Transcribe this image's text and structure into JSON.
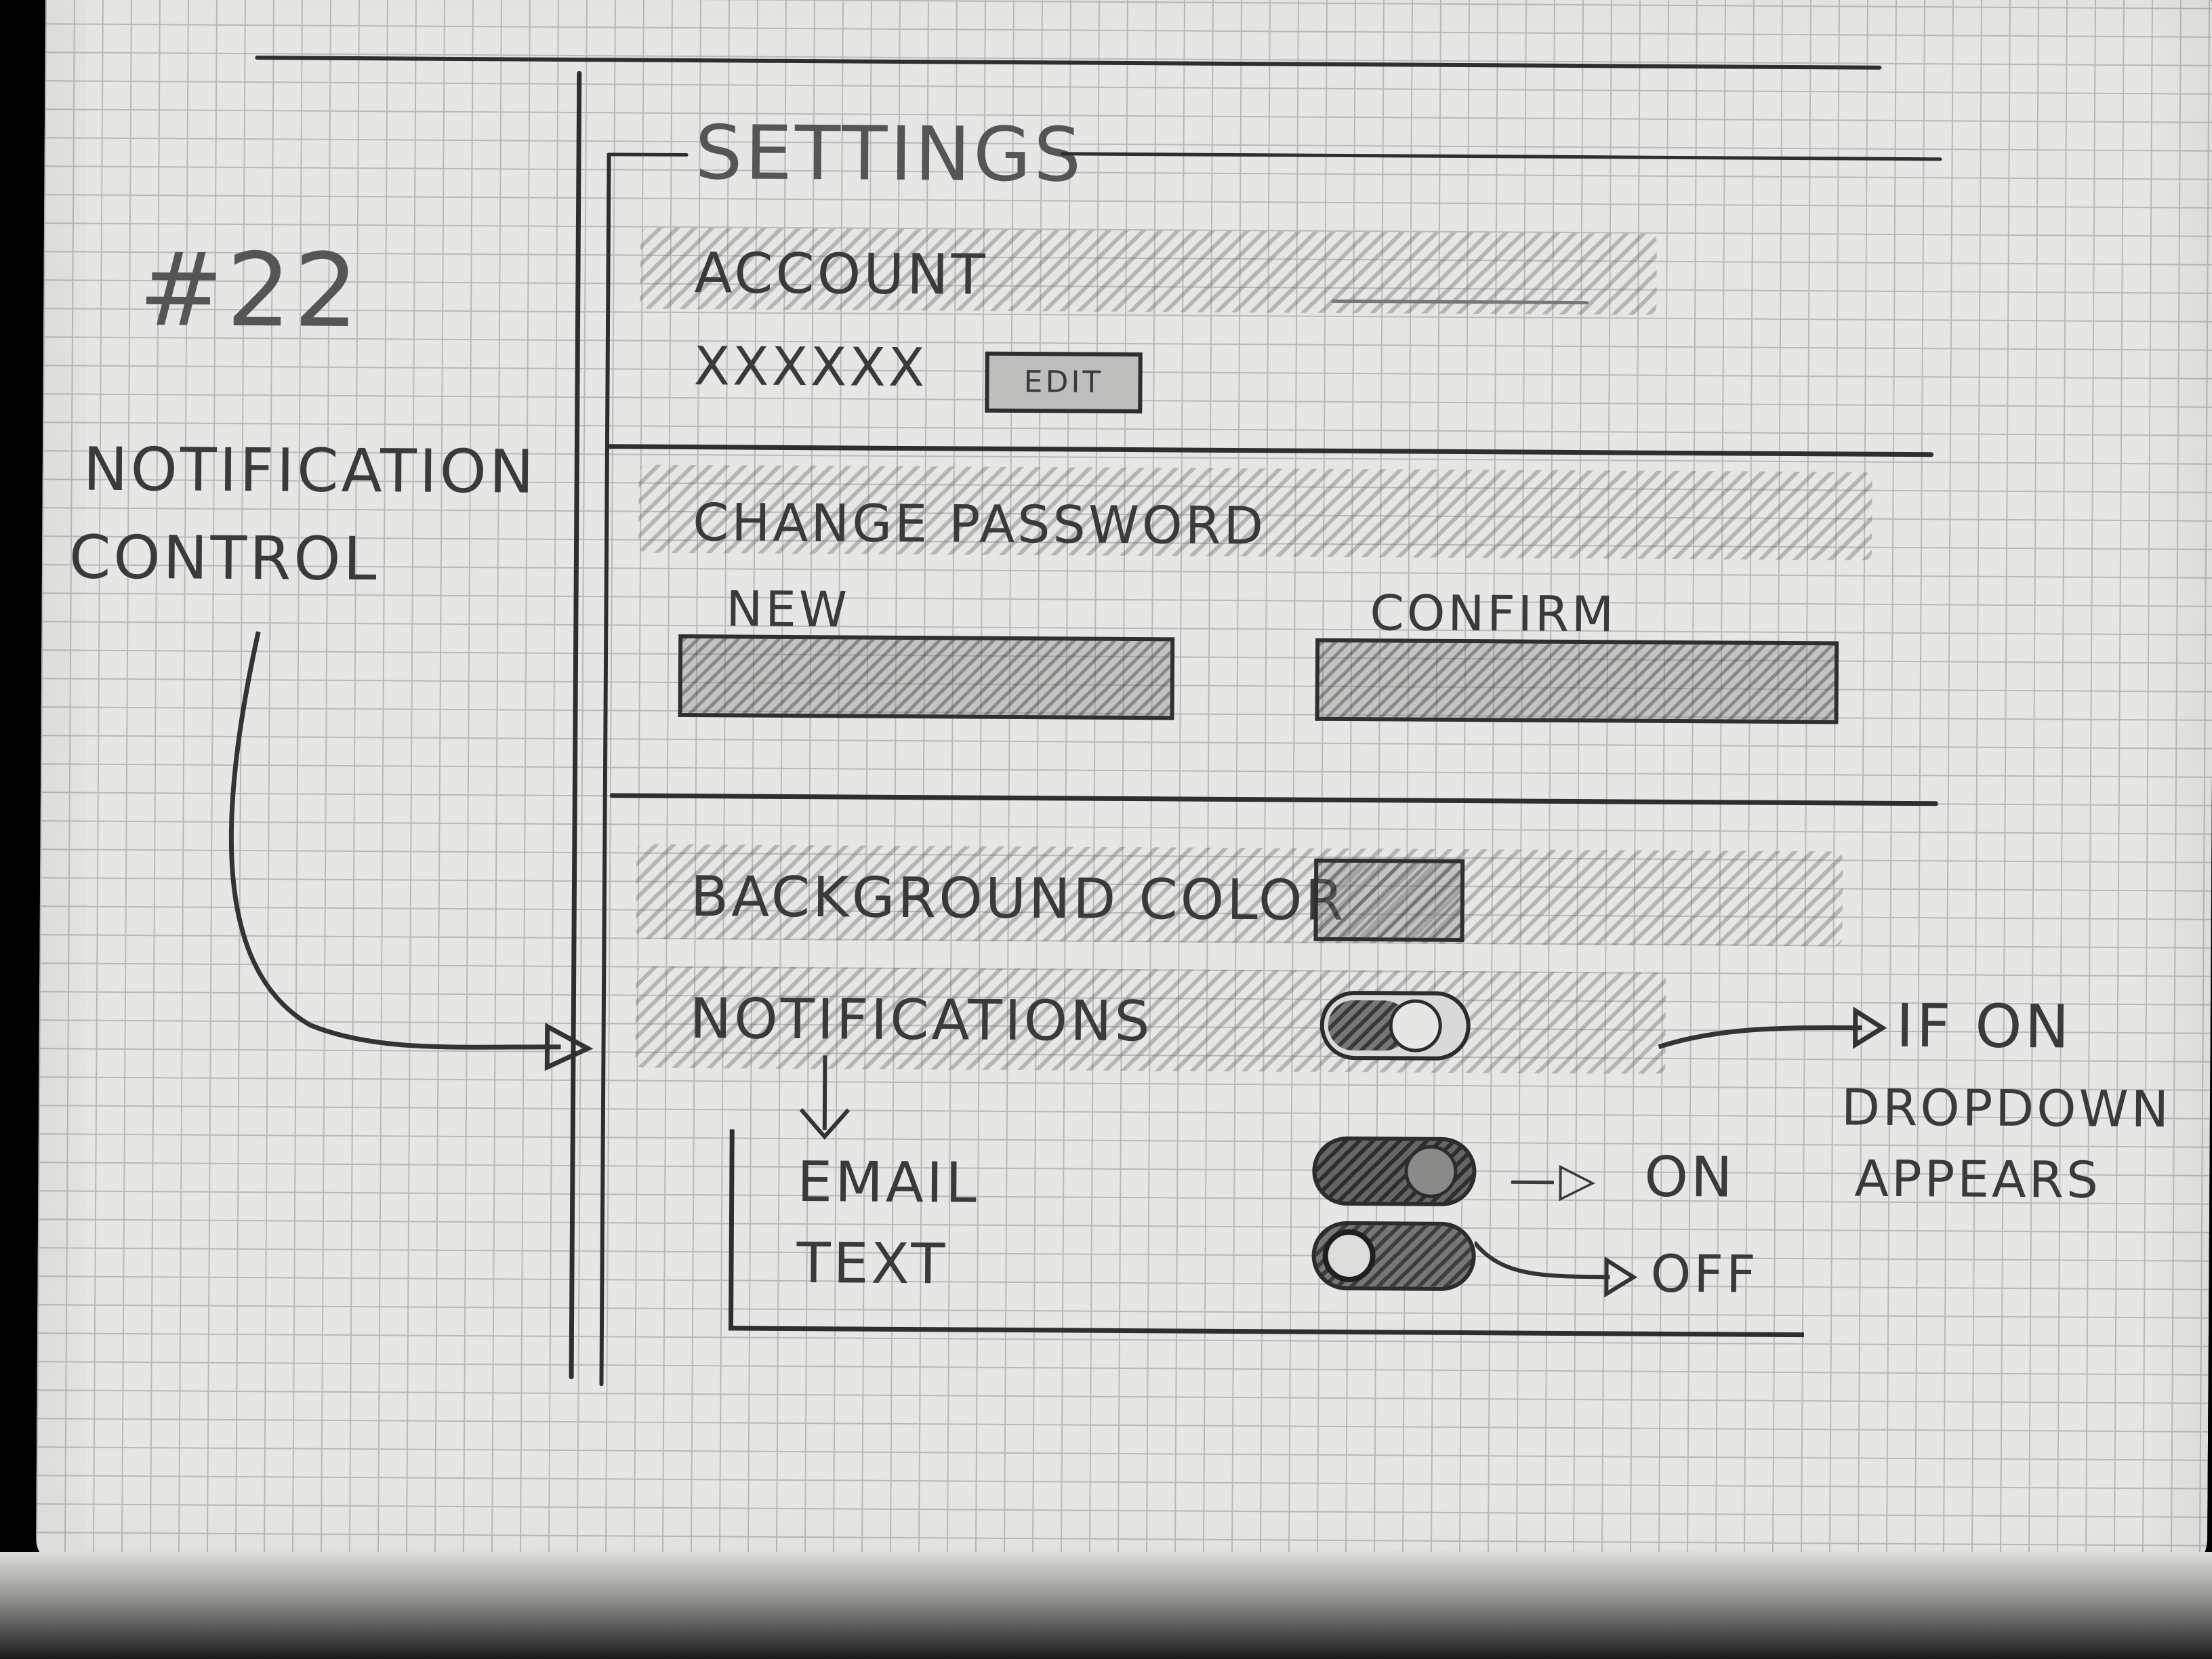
{
  "sketch_number": "#22",
  "side_note": {
    "line1": "NOTIFICATION",
    "line2": "CONTROL"
  },
  "settings": {
    "title": "SETTINGS",
    "account": {
      "label": "ACCOUNT",
      "value": "XXXXXX",
      "edit_label": "EDIT"
    },
    "change_password": {
      "label": "CHANGE PASSWORD",
      "new_label": "NEW",
      "confirm_label": "CONFIRM"
    },
    "background_color": {
      "label": "BACKGROUND COLOR"
    },
    "notifications": {
      "label": "NOTIFICATIONS",
      "state": "on",
      "sub": {
        "email_label": "EMAIL",
        "email_state": "on",
        "text_label": "TEXT",
        "text_state": "off"
      }
    }
  },
  "annotations": {
    "if_on_line1": "IF ON",
    "if_on_line2": "DROPDOWN",
    "if_on_line3": "APPEARS",
    "on_note": "ON",
    "off_note": "OFF"
  }
}
